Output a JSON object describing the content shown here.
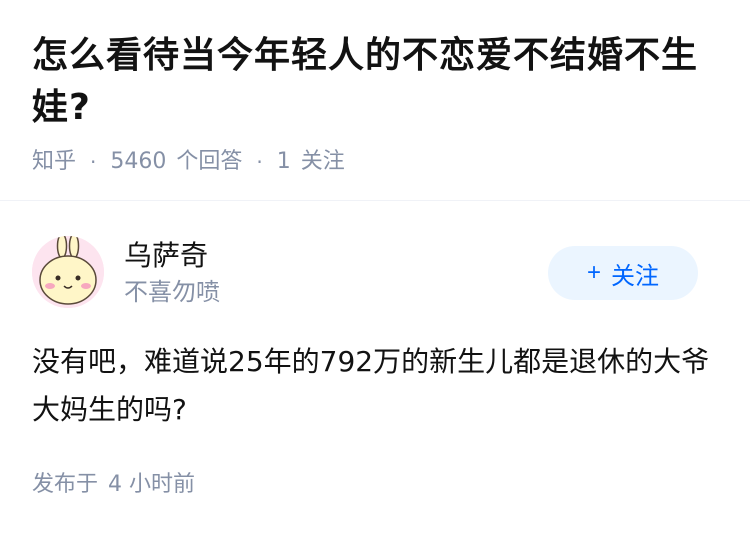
{
  "question": {
    "title": "怎么看待当今年轻人的不恋爱不结婚不生娃?",
    "source": "知乎",
    "answer_count": "5460",
    "answer_count_label": "个回答",
    "follower_count": "1",
    "follower_label": "关注"
  },
  "author": {
    "name": "乌萨奇",
    "bio": "不喜勿喷",
    "follow_button": {
      "icon": "+",
      "label": "关注"
    }
  },
  "answer": {
    "text": "没有吧，难道说25年的792万的新生儿都是退休的大爷大妈生的吗?"
  },
  "posted": {
    "label": "发布于",
    "time": "4 小时前"
  },
  "colors": {
    "accent": "#0066ff",
    "accent_bg": "#ebf5ff",
    "meta_text": "#8590a6",
    "main_text": "#121212"
  }
}
